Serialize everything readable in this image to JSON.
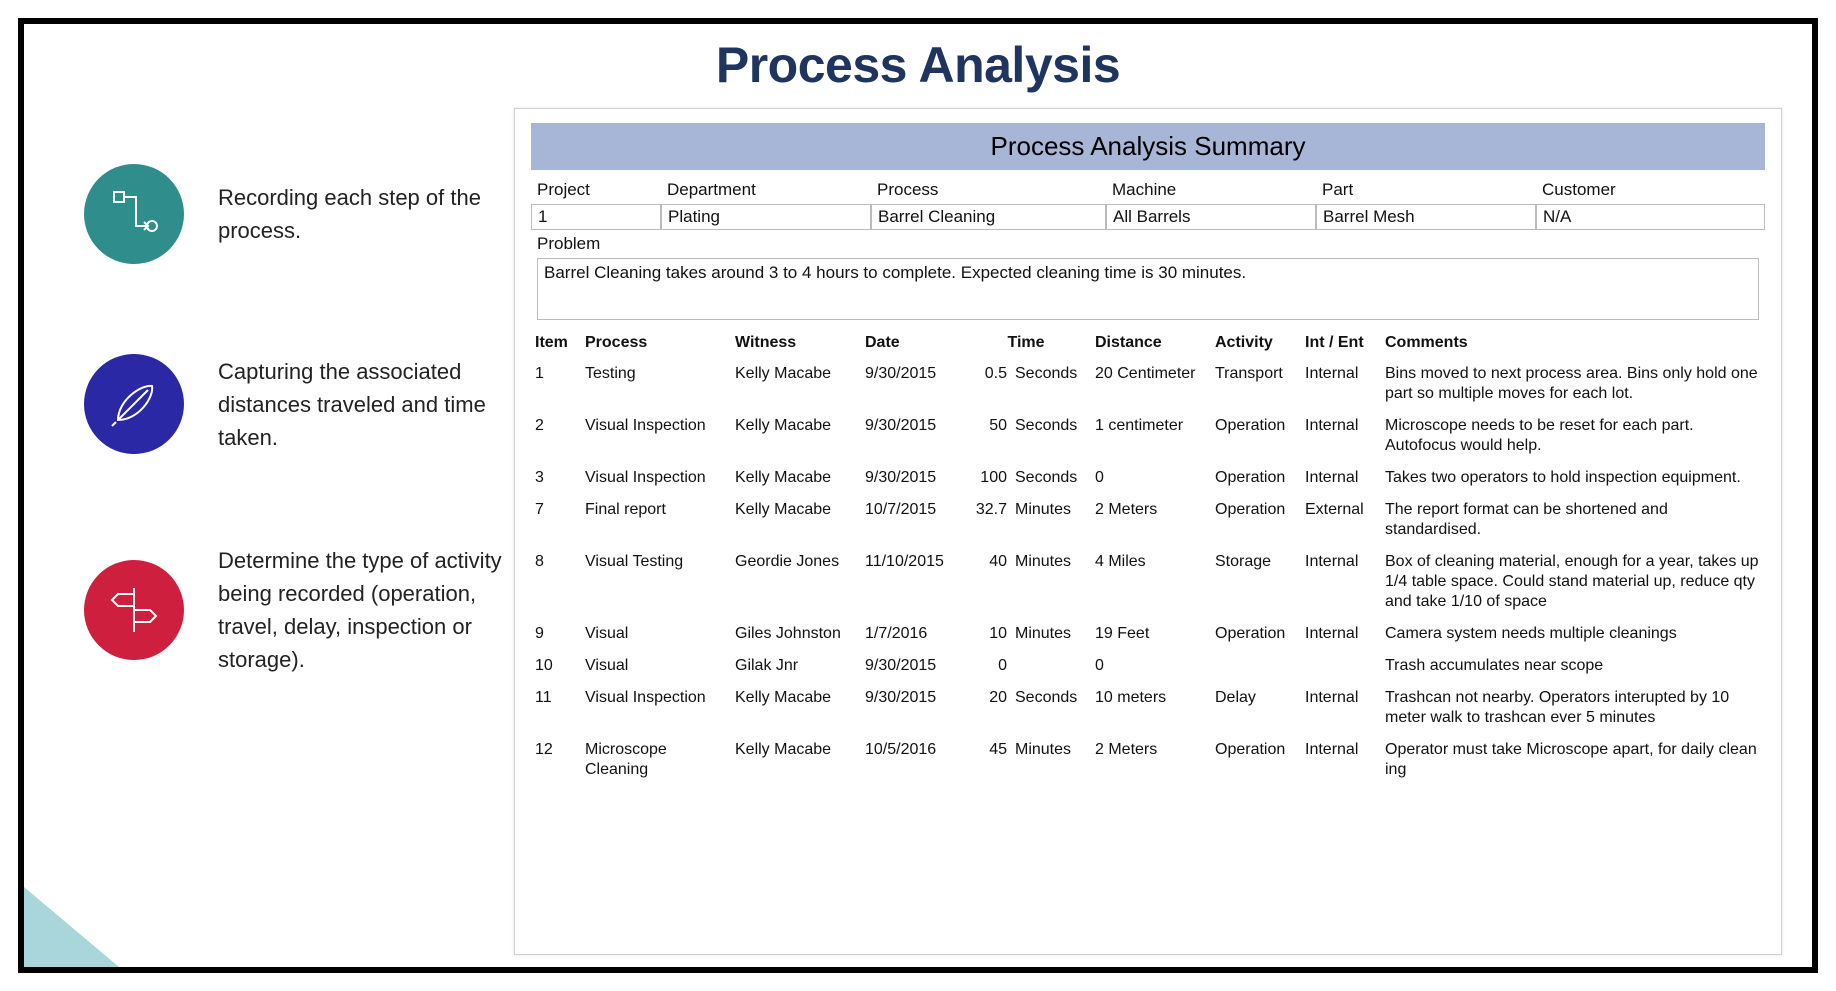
{
  "title": "Process Analysis",
  "bullets": [
    {
      "text": "Recording each step of the process.",
      "icon": "flow-icon",
      "color": "ic-teal"
    },
    {
      "text": "Capturing the associated distances traveled and time taken.",
      "icon": "feather-icon",
      "color": "ic-blue"
    },
    {
      "text": "Determine the type of activity being recorded (operation, travel, delay, inspection or storage).",
      "icon": "signpost-icon",
      "color": "ic-red"
    }
  ],
  "panel": {
    "header": "Process Analysis Summary",
    "meta_labels": {
      "project": "Project",
      "department": "Department",
      "process": "Process",
      "machine": "Machine",
      "part": "Part",
      "customer": "Customer",
      "problem": "Problem"
    },
    "meta": {
      "project": "1",
      "department": "Plating",
      "process": "Barrel Cleaning",
      "machine": "All Barrels",
      "part": "Barrel Mesh",
      "customer": "N/A"
    },
    "problem": "Barrel Cleaning takes around 3 to 4 hours to complete. Expected cleaning time is 30 minutes.",
    "columns": {
      "item": "Item",
      "process": "Process",
      "witness": "Witness",
      "date": "Date",
      "time": "Time",
      "distance": "Distance",
      "activity": "Activity",
      "intent": "Int / Ent",
      "comments": "Comments"
    },
    "rows": [
      {
        "item": "1",
        "process": "Testing",
        "witness": "Kelly Macabe",
        "date": "9/30/2015",
        "time_n": "0.5",
        "time_u": "Seconds",
        "distance": "20 Centimeter",
        "activity": "Transport",
        "intent": "Internal",
        "comments": "Bins moved to next process area. Bins only hold one part so multiple moves for each lot."
      },
      {
        "item": "2",
        "process": "Visual Inspection",
        "witness": "Kelly Macabe",
        "date": "9/30/2015",
        "time_n": "50",
        "time_u": "Seconds",
        "distance": "1 centimeter",
        "activity": "Operation",
        "intent": "Internal",
        "comments": "Microscope needs to be reset for each part. Autofocus would help."
      },
      {
        "item": "3",
        "process": "Visual Inspection",
        "witness": "Kelly Macabe",
        "date": "9/30/2015",
        "time_n": "100",
        "time_u": "Seconds",
        "distance": "0",
        "activity": "Operation",
        "intent": "Internal",
        "comments": "Takes two operators to hold inspection equipment."
      },
      {
        "item": "7",
        "process": "Final report",
        "witness": "Kelly Macabe",
        "date": "10/7/2015",
        "time_n": "32.7",
        "time_u": "Minutes",
        "distance": "2 Meters",
        "activity": "Operation",
        "intent": "External",
        "comments": "The report format can be shortened and standardised."
      },
      {
        "item": "8",
        "process": "Visual Testing",
        "witness": "Geordie Jones",
        "date": "11/10/2015",
        "time_n": "40",
        "time_u": "Minutes",
        "distance": "4 Miles",
        "activity": "Storage",
        "intent": "Internal",
        "comments": "Box of cleaning material, enough for a year, takes up 1/4 table space. Could stand material up, reduce qty and take 1/10 of space"
      },
      {
        "item": "9",
        "process": "Visual",
        "witness": "Giles Johnston",
        "date": "1/7/2016",
        "time_n": "10",
        "time_u": "Minutes",
        "distance": "19 Feet",
        "activity": "Operation",
        "intent": "Internal",
        "comments": "Camera system needs multiple cleanings"
      },
      {
        "item": "10",
        "process": "Visual",
        "witness": "Gilak Jnr",
        "date": "9/30/2015",
        "time_n": "0",
        "time_u": "",
        "distance": "0",
        "activity": "",
        "intent": "",
        "comments": "Trash accumulates near scope"
      },
      {
        "item": "11",
        "process": "Visual Inspection",
        "witness": "Kelly Macabe",
        "date": "9/30/2015",
        "time_n": "20",
        "time_u": "Seconds",
        "distance": "10 meters",
        "activity": "Delay",
        "intent": "Internal",
        "comments": "Trashcan not nearby. Operators interupted by 10 meter walk to trashcan ever 5 minutes"
      },
      {
        "item": "12",
        "process": "Microscope Cleaning",
        "witness": "Kelly Macabe",
        "date": "10/5/2016",
        "time_n": "45",
        "time_u": "Minutes",
        "distance": "2 Meters",
        "activity": "Operation",
        "intent": "Internal",
        "comments": "Operator must take Microscope apart, for daily clean\ning"
      }
    ]
  }
}
